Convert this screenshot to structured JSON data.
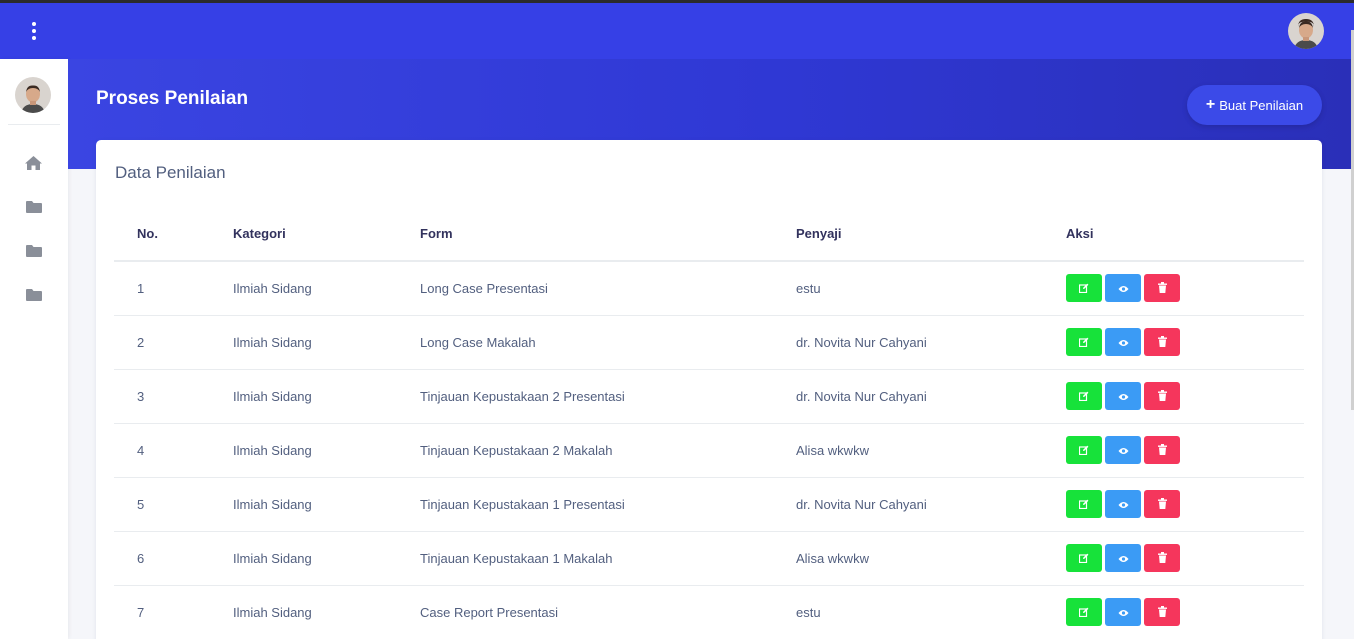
{
  "header": {
    "title": "Proses Penilaian",
    "create_button": {
      "label": "Buat Penilaian",
      "icon": "plus-icon"
    }
  },
  "sidebar": {
    "items": [
      {
        "icon": "home-icon"
      },
      {
        "icon": "folder-icon"
      },
      {
        "icon": "folder-icon"
      },
      {
        "icon": "folder-icon"
      }
    ]
  },
  "card": {
    "title": "Data Penilaian",
    "columns": [
      "No.",
      "Kategori",
      "Form",
      "Penyaji",
      "Aksi"
    ],
    "rows": [
      {
        "no": "1",
        "kategori": "Ilmiah Sidang",
        "form": "Long Case Presentasi",
        "penyaji": "estu"
      },
      {
        "no": "2",
        "kategori": "Ilmiah Sidang",
        "form": "Long Case Makalah",
        "penyaji": "dr. Novita Nur Cahyani"
      },
      {
        "no": "3",
        "kategori": "Ilmiah Sidang",
        "form": "Tinjauan Kepustakaan 2 Presentasi",
        "penyaji": "dr. Novita Nur Cahyani"
      },
      {
        "no": "4",
        "kategori": "Ilmiah Sidang",
        "form": "Tinjauan Kepustakaan 2 Makalah",
        "penyaji": "Alisa wkwkw"
      },
      {
        "no": "5",
        "kategori": "Ilmiah Sidang",
        "form": "Tinjauan Kepustakaan 1 Presentasi",
        "penyaji": "dr. Novita Nur Cahyani"
      },
      {
        "no": "6",
        "kategori": "Ilmiah Sidang",
        "form": "Tinjauan Kepustakaan 1 Makalah",
        "penyaji": "Alisa wkwkw"
      },
      {
        "no": "7",
        "kategori": "Ilmiah Sidang",
        "form": "Case Report Presentasi",
        "penyaji": "estu"
      }
    ]
  },
  "colors": {
    "primary": "#3640e6",
    "edit": "#17e23a",
    "view": "#3b9bf5",
    "delete": "#f5365c"
  }
}
